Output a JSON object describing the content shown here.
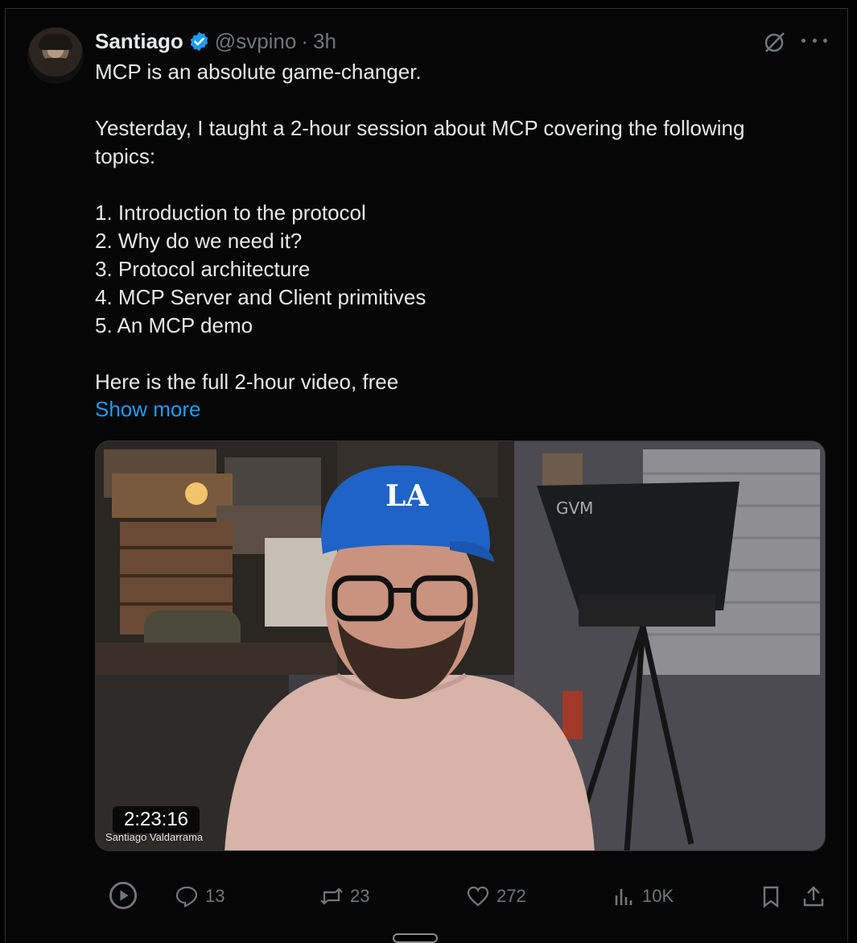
{
  "tweet": {
    "author_name": "Santiago",
    "handle": "@svpino",
    "separator": "·",
    "time": "3h",
    "text": "MCP is an absolute game-changer.\n\nYesterday, I taught a 2-hour session about MCP covering the following topics:\n\n1. Introduction to the protocol\n2. Why do we need it?\n3. Protocol architecture\n4. MCP Server and Client primitives\n5. An MCP demo\n\nHere is the full 2-hour video, free",
    "show_more": "Show more"
  },
  "video": {
    "duration": "2:23:16",
    "overlay_name": "Santiago Valdarrama",
    "cap_text": "LA",
    "device_brand": "GVM"
  },
  "actions": {
    "replies": "13",
    "reposts": "23",
    "likes": "272",
    "views": "10K"
  },
  "icons": {
    "verified": "verified-badge-icon",
    "grok": "grok-icon",
    "more": "more-icon",
    "play": "play-icon",
    "reply": "reply-icon",
    "repost": "repost-icon",
    "like": "heart-icon",
    "views": "views-icon",
    "bookmark": "bookmark-icon",
    "share": "share-icon"
  },
  "colors": {
    "background": "#000000",
    "text": "#e7e9ea",
    "muted": "#71767b",
    "link": "#1d9bf0",
    "verified": "#1d9bf0"
  }
}
